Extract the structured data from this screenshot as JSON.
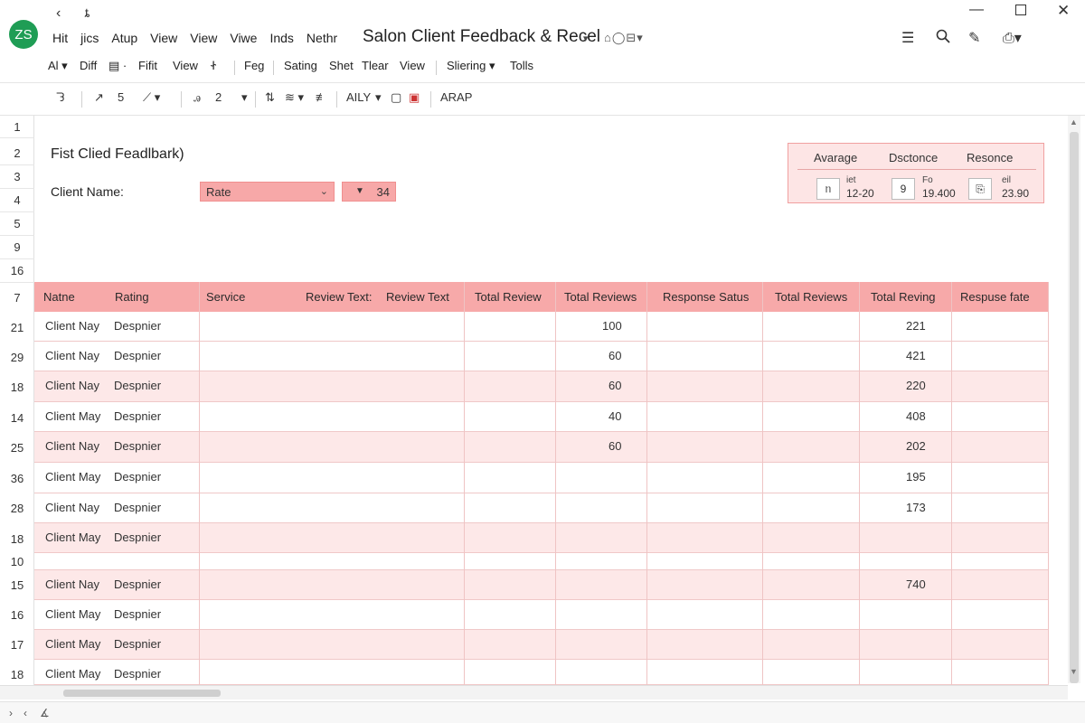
{
  "app": {
    "logo_text": "ZS",
    "title": "Salon Client Feedback & Recel",
    "menu": [
      "Hit",
      "jics",
      "Atup",
      "View",
      "View",
      "Viwe",
      "Inds",
      "Nethr"
    ],
    "nav_back": "‹",
    "nav_forward": "ȶ"
  },
  "ribbon": {
    "items": [
      "Al ▾",
      "Diff",
      "▤ ·",
      "Fifit",
      "View",
      "Ꮠ",
      "Feg",
      "Sating",
      "Shet",
      "Tlear",
      "View",
      "Sliering ▾",
      "Tolls"
    ]
  },
  "toolbar": {
    "items": [
      "ᘊ",
      "↗",
      "5",
      "⟋ ▾",
      "ꭿ",
      "2",
      "▾",
      "⇅",
      "≋ ▾",
      "≢",
      "AILY",
      "▾",
      "▢",
      "▣",
      "ARAP"
    ]
  },
  "row_numbers": [
    "1",
    "2",
    "3",
    "4",
    "5",
    "9",
    "16",
    "7",
    "21",
    "29",
    "18",
    "14",
    "25",
    "36",
    "28",
    "18",
    "10",
    "15",
    "16",
    "17",
    "18"
  ],
  "form": {
    "title": "Fist Clied Feadlbark)",
    "client_label": "Client Name:",
    "rate_value": "Rate",
    "count_value": "34"
  },
  "summary": {
    "headers": [
      "Avarage",
      "Dsctonce",
      "Resonce"
    ],
    "items": [
      {
        "icon": "ᥒ",
        "small": "iet",
        "value": "12-20"
      },
      {
        "icon": "9",
        "small": "Fo",
        "value": "19.400"
      },
      {
        "icon": "⎘",
        "small": "eil",
        "value": "23.90"
      }
    ]
  },
  "table": {
    "headers": [
      "Natne",
      "Rating",
      "Service",
      "Review Text:",
      "Review Text",
      "Total Review",
      "Total Reviews",
      "Response Satus",
      "Total Reviews",
      "Total Reving",
      "Respuse fate"
    ],
    "rows": [
      {
        "name": "Client Nay",
        "rating": "Despnier",
        "reviews": "100",
        "reving": "221"
      },
      {
        "name": "Client Nay",
        "rating": "Despnier",
        "reviews": "60",
        "reving": "421"
      },
      {
        "name": "Client Nay",
        "rating": "Despnier",
        "reviews": "60",
        "reving": "220"
      },
      {
        "name": "Client May",
        "rating": "Despnier",
        "reviews": "40",
        "reving": "408"
      },
      {
        "name": "Client Nay",
        "rating": "Despnier",
        "reviews": "60",
        "reving": "202"
      },
      {
        "name": "Client May",
        "rating": "Despnier",
        "reviews": "",
        "reving": "195"
      },
      {
        "name": "Client Nay",
        "rating": "Despnier",
        "reviews": "",
        "reving": "173"
      },
      {
        "name": "Client May",
        "rating": "Despnier",
        "reviews": "",
        "reving": ""
      },
      {
        "name": "",
        "rating": "",
        "reviews": "",
        "reving": ""
      },
      {
        "name": "Client Nay",
        "rating": "Despnier",
        "reviews": "",
        "reving": "740"
      },
      {
        "name": "Client May",
        "rating": "Despnier",
        "reviews": "",
        "reving": ""
      },
      {
        "name": "Client May",
        "rating": "Despnier",
        "reviews": "",
        "reving": ""
      },
      {
        "name": "Client May",
        "rating": "Despnier",
        "reviews": "",
        "reving": ""
      }
    ]
  },
  "colors": {
    "accent": "#f7a9a9",
    "row_alt": "#fde8e8",
    "logo": "#1f9d55"
  }
}
